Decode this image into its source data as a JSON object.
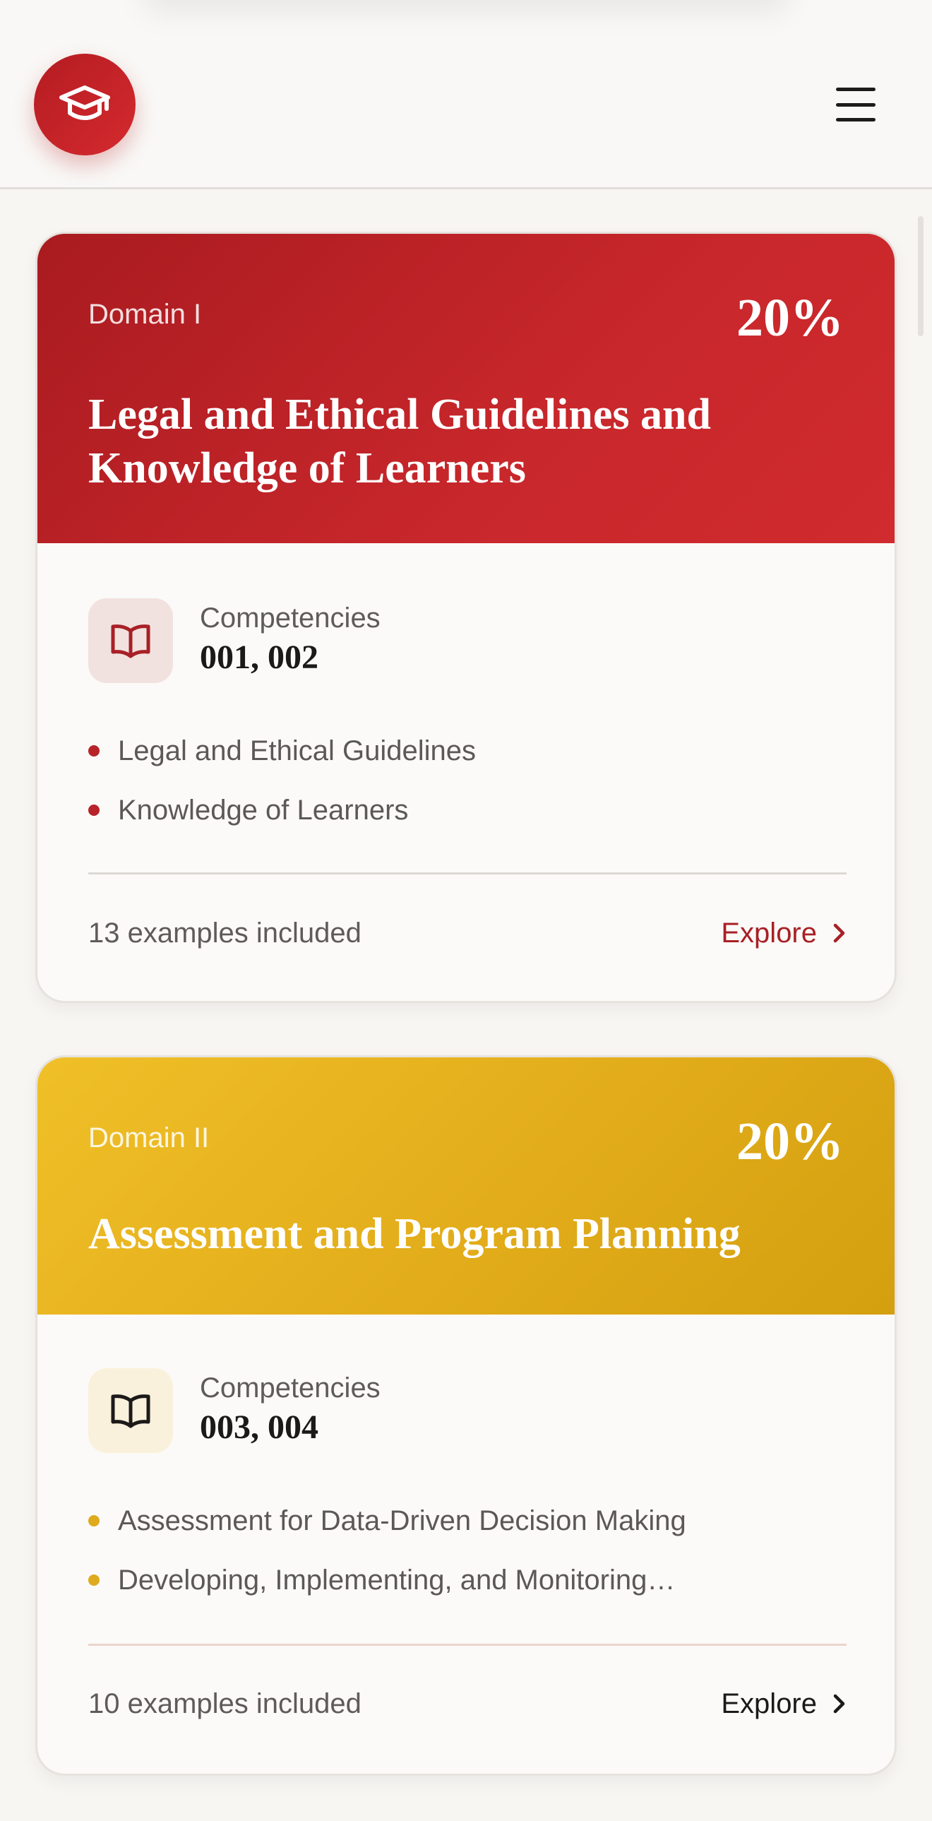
{
  "header": {
    "logo_icon": "graduation-cap-icon",
    "menu_icon": "hamburger-menu-icon"
  },
  "colors": {
    "brand_red": "#b41c22",
    "domain_gold": "#e2ac1a",
    "background": "#f8f6f3"
  },
  "domains": [
    {
      "label": "Domain I",
      "percent": "20%",
      "title": "Legal and Ethical Guidelines and Knowledge of Learners",
      "competencies_label": "Competencies",
      "competencies_value": "001, 002",
      "topics": [
        "Legal and Ethical Guidelines",
        "Knowledge of Learners"
      ],
      "examples": "13 examples included",
      "explore_label": "Explore"
    },
    {
      "label": "Domain II",
      "percent": "20%",
      "title": "Assessment and Program Planning",
      "competencies_label": "Competencies",
      "competencies_value": "003, 004",
      "topics": [
        "Assessment for Data-Driven Decision Making",
        "Developing, Implementing, and Monitoring…"
      ],
      "examples": "10 examples included",
      "explore_label": "Explore"
    }
  ]
}
